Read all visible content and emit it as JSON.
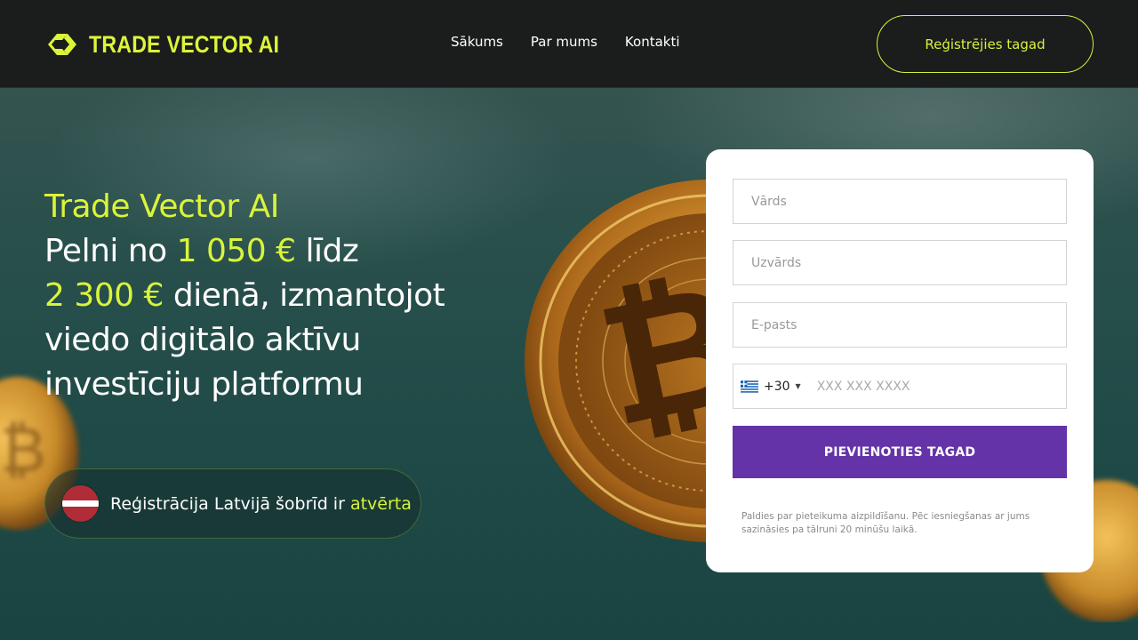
{
  "brand": {
    "name": "TRADE VECTOR AI",
    "accent": "#d9f43a"
  },
  "nav": {
    "items": [
      "Sākums",
      "Par mums",
      "Kontakti"
    ]
  },
  "header": {
    "cta_label": "Reģistrējies tagad"
  },
  "hero": {
    "title": "Trade Vector AI",
    "line1_a": "Pelni no ",
    "line1_b": "1 050 €",
    "line1_c": " līdz",
    "line2_a": "2 300 €",
    "line2_b": " dienā, izmantojot",
    "line3": "viedo digitālo aktīvu",
    "line4": "investīciju platformu"
  },
  "registration": {
    "text": "Reģistrācija Latvijā šobrīd ir ",
    "status": "atvērta"
  },
  "form": {
    "first_name_placeholder": "Vārds",
    "last_name_placeholder": "Uzvārds",
    "email_placeholder": "E-pasts",
    "phone_code": "+30",
    "phone_placeholder": "XXX XXX XXXX",
    "submit_label": "PIEVIENOTIES TAGAD",
    "note": "Paldies par pieteikuma aizpildīšanu. Pēc iesniegšanas ar jums sazināsies pa tālruni 20 minūšu laikā.",
    "submit_color": "#6433a7"
  }
}
